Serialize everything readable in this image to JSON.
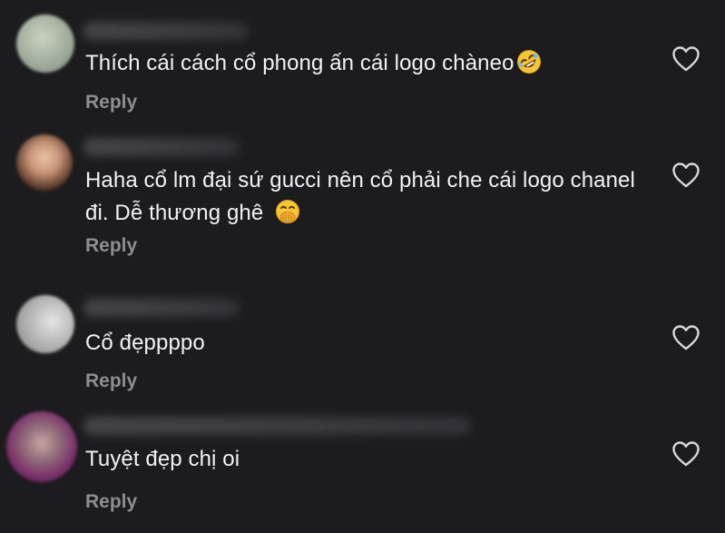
{
  "comments": [
    {
      "text": "Thích cái cách cổ phong ấn cái logo chàneo",
      "emoji": "rolling-on-floor-laughing-emoji",
      "reply_label": "Reply"
    },
    {
      "text": "Haha cổ lm đại sứ gucci nên cổ phải che cái logo chanel đi. Dễ thương ghê",
      "emoji": "hand-over-mouth-emoji",
      "reply_label": "Reply"
    },
    {
      "text": "Cổ đẹppppo",
      "emoji": "",
      "reply_label": "Reply"
    },
    {
      "text": "Tuyệt đẹp chị oi",
      "emoji": "",
      "reply_label": "Reply"
    }
  ],
  "icons": {
    "like": "heart-outline-icon"
  },
  "colors": {
    "background": "#1c1c1e",
    "text": "#f2f2f4",
    "reply": "#8e8e93",
    "icon": "#d8d8dc"
  }
}
